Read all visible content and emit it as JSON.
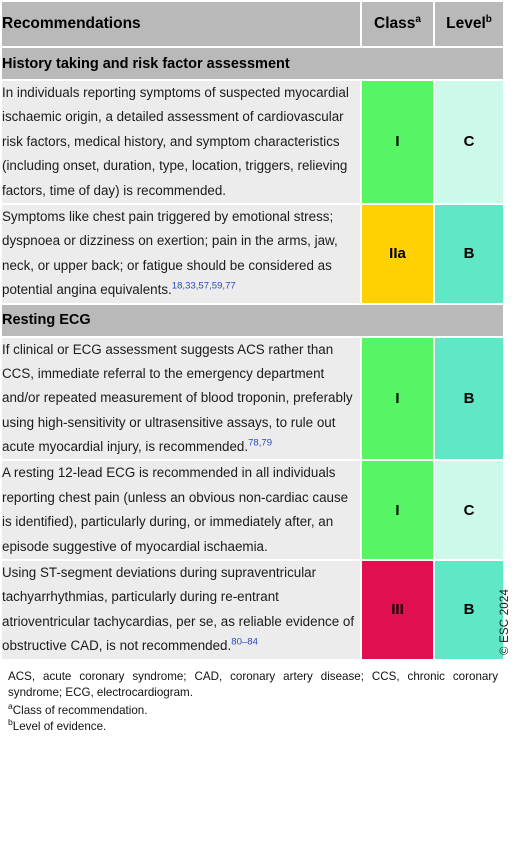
{
  "table": {
    "columns": [
      {
        "label": "Recommendations",
        "footnote_marker": ""
      },
      {
        "label": "Class",
        "footnote_marker": "a"
      },
      {
        "label": "Level",
        "footnote_marker": "b"
      }
    ],
    "sections": [
      {
        "title": "History taking and risk factor assessment",
        "rows": [
          {
            "text": "In individuals reporting symptoms of suspected myocardial ischaemic origin, a detailed assessment of cardiovascular risk factors, medical history, and symptom characteristics (including onset, duration, type, location, triggers, relieving factors, time of day) is recommended.",
            "citations": "",
            "class": "I",
            "level": "C"
          },
          {
            "text": "Symptoms like chest pain triggered by emotional stress; dyspnoea or dizziness on exertion; pain in the arms, jaw, neck, or upper back; or fatigue should be considered as potential angina equivalents.",
            "citations": "18,33,57,59,77",
            "class": "IIa",
            "level": "B"
          }
        ]
      },
      {
        "title": "Resting ECG",
        "rows": [
          {
            "text": "If clinical or ECG assessment suggests ACS rather than CCS, immediate referral to the emergency department and/or repeated measurement of blood troponin, preferably using high-sensitivity or ultrasensitive assays, to rule out acute myocardial injury, is recommended.",
            "citations": "78,79",
            "class": "I",
            "level": "B"
          },
          {
            "text": "A resting 12-lead ECG is recommended in all individuals reporting chest pain (unless an obvious non-cardiac cause is identified), particularly during, or immediately after, an episode suggestive of myocardial ischaemia.",
            "citations": "",
            "class": "I",
            "level": "C"
          },
          {
            "text": "Using ST-segment deviations during supraventricular tachyarrhythmias, particularly during re-entrant atrioventricular tachycardias, per se, as reliable evidence of obstructive CAD, is not recommended.",
            "citations": "80–84",
            "class": "III",
            "level": "B"
          }
        ]
      }
    ]
  },
  "footnotes": {
    "abbreviations": "ACS, acute coronary syndrome; CAD, coronary artery disease; CCS, chronic coronary syndrome; ECG, electrocardiogram.",
    "note_a_marker": "a",
    "note_a": "Class of recommendation.",
    "note_b_marker": "b",
    "note_b": "Level of evidence."
  },
  "copyright": "© ESC 2024",
  "colors": {
    "header_gray": "#b9b9b9",
    "cell_gray": "#ececec",
    "class_i_green": "#55f563",
    "class_iia_yellow": "#ffd100",
    "class_iii_crimson": "#e00f50",
    "level_b_teal": "#5fe7c6",
    "level_c_mint": "#ccf9e9",
    "citation_blue": "#2b4cc4"
  }
}
